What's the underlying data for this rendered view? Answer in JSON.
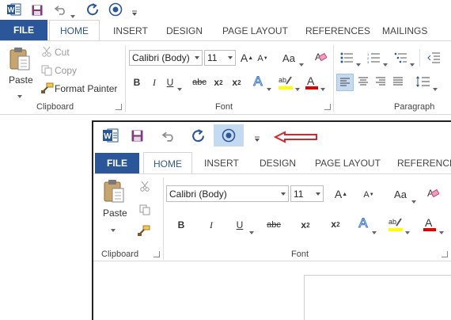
{
  "back_window": {
    "tabs": [
      "FILE",
      "HOME",
      "INSERT",
      "DESIGN",
      "PAGE LAYOUT",
      "REFERENCES",
      "MAILINGS"
    ],
    "clipboard": {
      "paste": "Paste",
      "cut": "Cut",
      "copy": "Copy",
      "format_painter": "Format Painter",
      "label": "Clipboard"
    },
    "font": {
      "name": "Calibri (Body)",
      "size": "11",
      "label": "Font"
    },
    "paragraph_label": "Paragraph"
  },
  "front_window": {
    "tabs": [
      "FILE",
      "HOME",
      "INSERT",
      "DESIGN",
      "PAGE LAYOUT",
      "REFERENCE"
    ],
    "clipboard": {
      "paste": "Paste",
      "label": "Clipboard"
    },
    "font": {
      "name": "Calibri (Body)",
      "size": "11",
      "label": "Font"
    }
  },
  "colors": {
    "file_tab": "#2b579a",
    "qat_highlight": "#c5d9f1",
    "arrow": "#d9262c",
    "highlight_yellow": "#ffff00",
    "font_red": "#e00000",
    "word_blue": "#2b579a",
    "save_purple": "#80397b"
  }
}
